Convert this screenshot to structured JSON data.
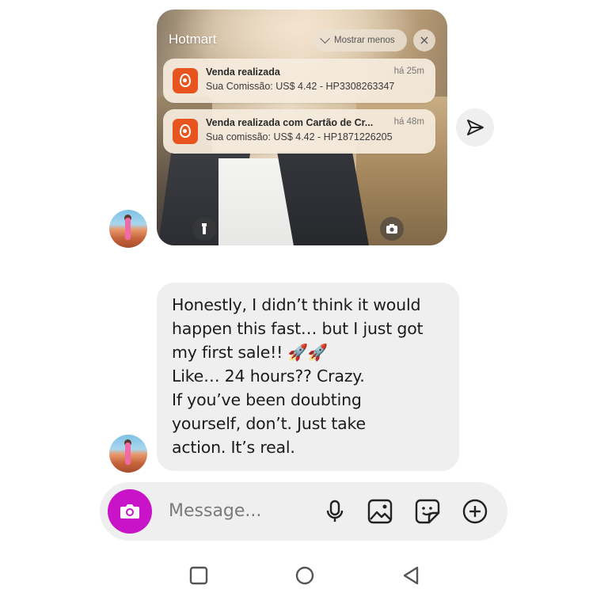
{
  "notification": {
    "app_name": "Hotmart",
    "collapse_label": "Mostrar menos",
    "close_symbol": "×",
    "accent_color": "#e8541e",
    "items": [
      {
        "title": "Venda realizada",
        "time": "há 25m",
        "body": "Sua Comissão: US$ 4.42 - HP3308263347"
      },
      {
        "title": "Venda realizada com Cartão de Cr...",
        "time": "há 48m",
        "body": "Sua comissão: US$ 4.42 - HP1871226205"
      }
    ]
  },
  "message": {
    "lines": [
      "Honestly, I didn’t think it would",
      "happen this fast… but I just got",
      "my first sale!! 🚀🚀",
      "Like… 24 hours?? Crazy.",
      "If you’ve been doubting",
      "yourself, don’t. Just take",
      "action. It’s real."
    ]
  },
  "composer": {
    "placeholder": "Message...",
    "camera_color": "#c913c9",
    "icons": [
      "microphone-icon",
      "image-icon",
      "sticker-icon",
      "plus-circle-icon"
    ]
  },
  "nav": {
    "icons": [
      "recents-square-icon",
      "home-circle-icon",
      "back-triangle-icon"
    ]
  }
}
